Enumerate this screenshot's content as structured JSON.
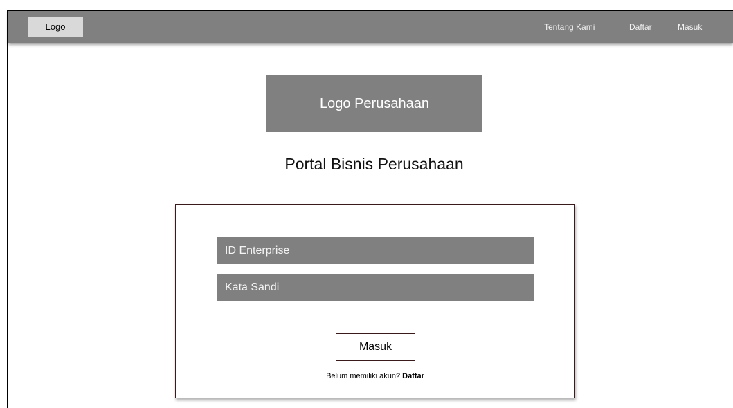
{
  "navbar": {
    "logo_label": "Logo",
    "links": [
      "Tentang Kami",
      "Daftar",
      "Masuk"
    ]
  },
  "hero": {
    "company_logo_label": "Logo Perusahaan",
    "title": "Portal Bisnis Perusahaan"
  },
  "login_form": {
    "id_placeholder": "ID Enterprise",
    "password_placeholder": "Kata Sandi",
    "submit_label": "Masuk",
    "signup_prompt": "Belum memiliki akun?",
    "signup_link": "Daftar"
  },
  "colors": {
    "bar": "#808080",
    "logo_box": "#d9d9d9",
    "card_border": "#3a1a1a"
  }
}
